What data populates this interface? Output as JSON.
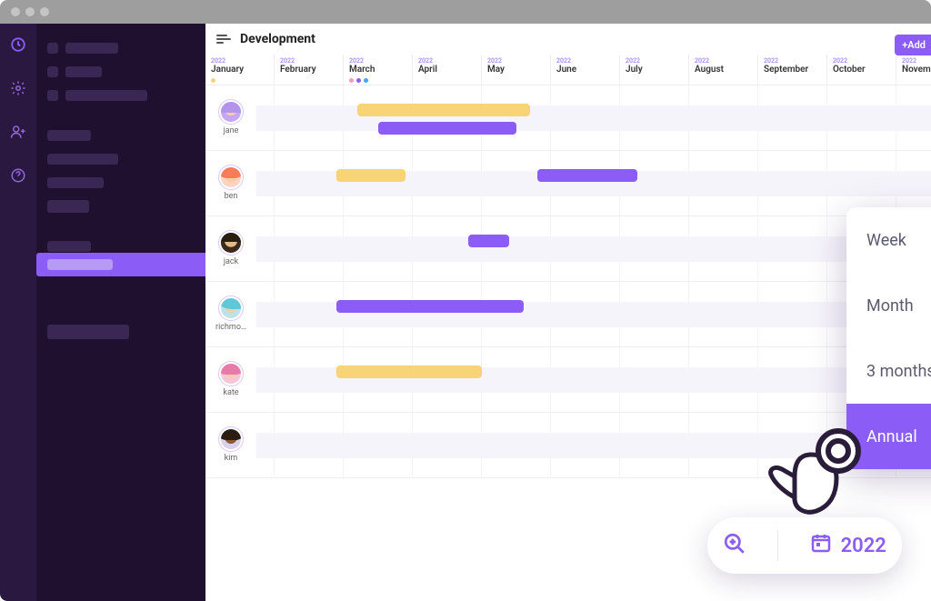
{
  "header": {
    "title": "Development",
    "add_label": "+Add"
  },
  "year": "2022",
  "months": [
    {
      "label": "January",
      "year": "2022",
      "dots": [
        "#f8d477"
      ]
    },
    {
      "label": "February",
      "year": "2022",
      "dots": []
    },
    {
      "label": "March",
      "year": "2022",
      "dots": [
        "#f49ac1",
        "#8b5cf6",
        "#4aa3ff"
      ]
    },
    {
      "label": "April",
      "year": "2022",
      "dots": []
    },
    {
      "label": "May",
      "year": "2022",
      "dots": []
    },
    {
      "label": "June",
      "year": "2022",
      "dots": []
    },
    {
      "label": "July",
      "year": "2022",
      "dots": []
    },
    {
      "label": "August",
      "year": "2022",
      "dots": []
    },
    {
      "label": "September",
      "year": "2022",
      "dots": []
    },
    {
      "label": "October",
      "year": "2022",
      "dots": []
    },
    {
      "label": "Novem",
      "year": "2022",
      "dots": []
    }
  ],
  "people": [
    {
      "name": "jane",
      "avatar": "av-jane",
      "bars": [
        {
          "color": "y",
          "start": 2.2,
          "span": 2.5,
          "lane": 1
        },
        {
          "color": "p",
          "start": 2.5,
          "span": 2.0,
          "lane": 2
        }
      ]
    },
    {
      "name": "ben",
      "avatar": "av-ben",
      "bars": [
        {
          "color": "y",
          "start": 1.9,
          "span": 1.0,
          "lane": 1
        },
        {
          "color": "p",
          "start": 4.8,
          "span": 1.45,
          "lane": 1
        }
      ]
    },
    {
      "name": "jack",
      "avatar": "av-jack",
      "bars": [
        {
          "color": "p",
          "start": 3.8,
          "span": 0.6,
          "lane": 1
        }
      ]
    },
    {
      "name": "richmo…",
      "avatar": "av-rich",
      "bars": [
        {
          "color": "p",
          "start": 1.9,
          "span": 2.7,
          "lane": 1
        }
      ]
    },
    {
      "name": "kate",
      "avatar": "av-kate",
      "bars": [
        {
          "color": "y",
          "start": 1.9,
          "span": 2.1,
          "lane": 1
        }
      ]
    },
    {
      "name": "kim",
      "avatar": "av-kim",
      "bars": []
    }
  ],
  "zoom_menu": {
    "items": [
      {
        "label": "Week",
        "key": "W",
        "active": false
      },
      {
        "label": "Month",
        "key": "M",
        "active": false
      },
      {
        "label": "3 months",
        "key": "Q",
        "active": false
      },
      {
        "label": "Annual",
        "key": "A",
        "active": true
      }
    ]
  },
  "year_pill": {
    "year": "2022"
  },
  "colors": {
    "accent": "#8b5cf6",
    "yellow": "#f8d477",
    "dark": "#1f1030"
  }
}
